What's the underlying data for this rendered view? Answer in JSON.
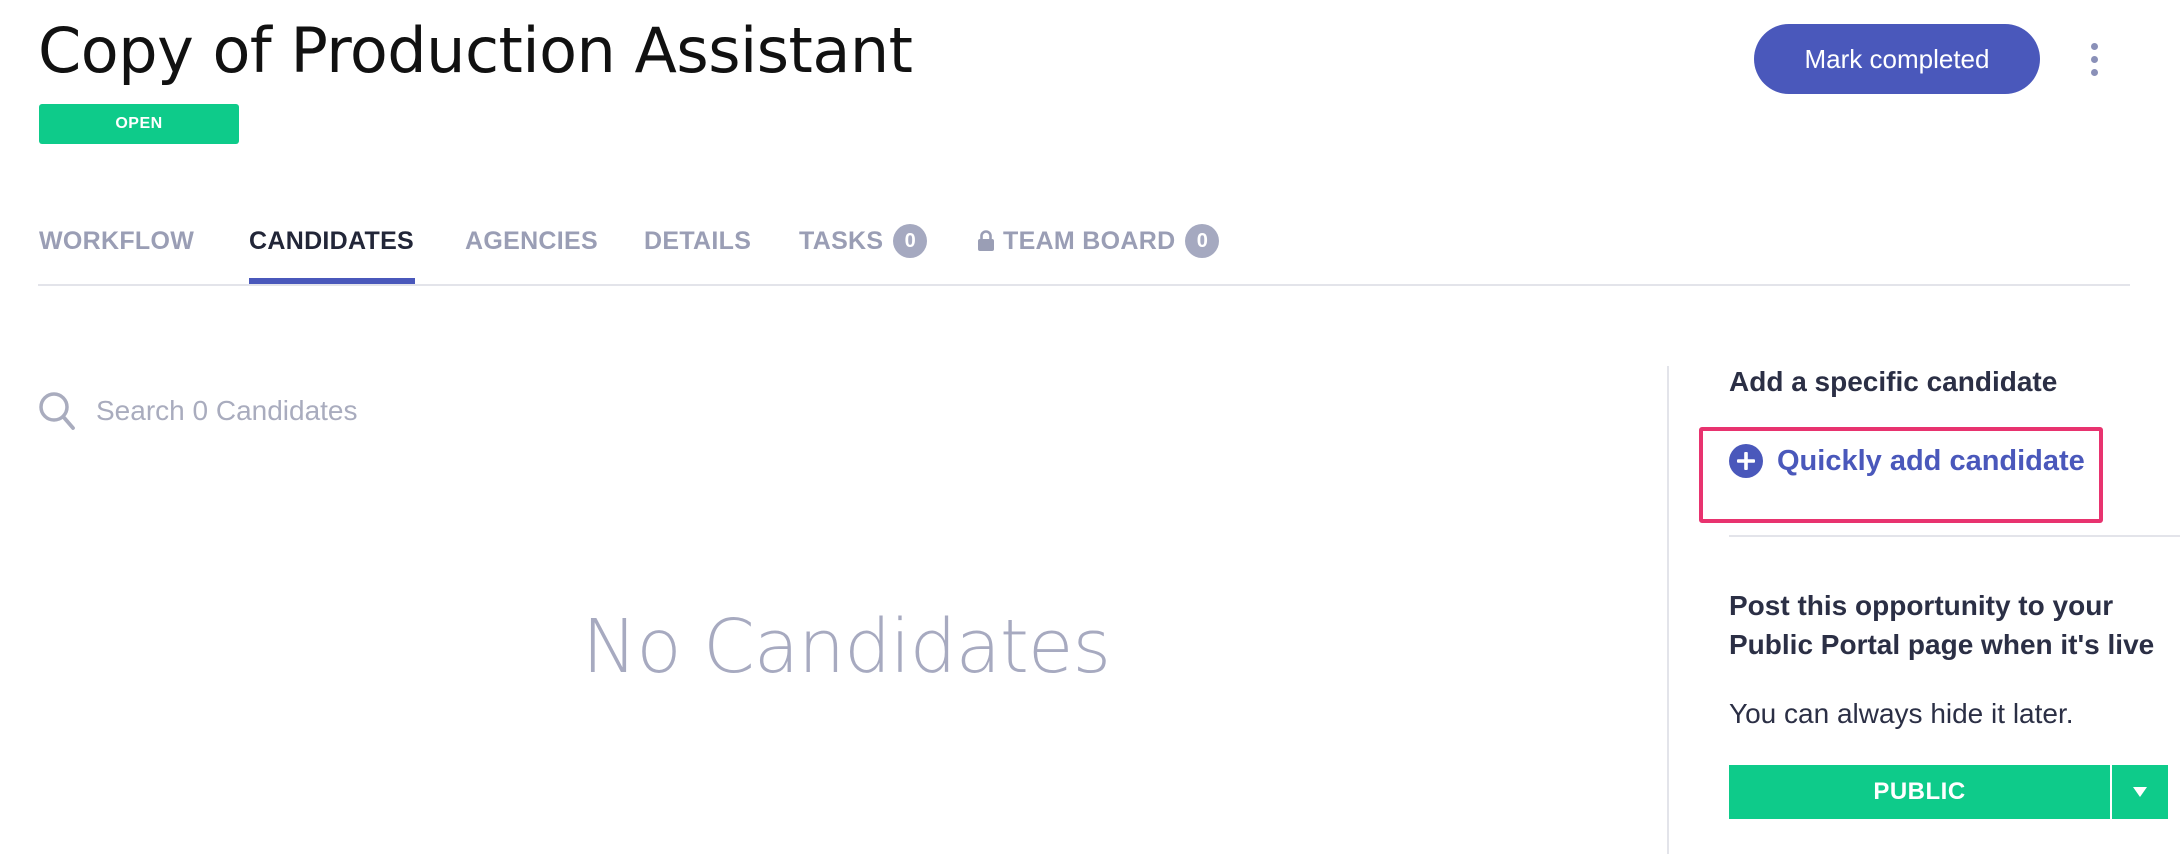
{
  "header": {
    "title": "Copy of Production Assistant",
    "status": "OPEN",
    "primary_action": "Mark completed",
    "more_icon": "kebab-vertical-icon"
  },
  "tabs": [
    {
      "label": "WORKFLOW",
      "count": null,
      "active": false
    },
    {
      "label": "CANDIDATES",
      "count": null,
      "active": true
    },
    {
      "label": "AGENCIES",
      "count": null,
      "active": false
    },
    {
      "label": "DETAILS",
      "count": null,
      "active": false
    },
    {
      "label": "TASKS",
      "count": "0",
      "active": false
    },
    {
      "label": "TEAM BOARD",
      "count": "0",
      "active": false,
      "icon": "lock-icon"
    }
  ],
  "search": {
    "placeholder": "Search 0 Candidates",
    "value": "",
    "icon": "search-icon"
  },
  "main": {
    "empty_message": "No Candidates"
  },
  "sidebar": {
    "heading": "Add a specific candidate",
    "quick_add_label": "Quickly add candidate",
    "quick_add_icon": "plus-circle-icon",
    "portal_text": "Post this opportunity to your Public Portal page when it's live",
    "hint": "You can always hide it later.",
    "visibility_value": "PUBLIC",
    "visibility_dropdown_icon": "caret-down-icon"
  },
  "colors": {
    "accent": "#4a58bb",
    "success": "#0ecb8a",
    "highlight": "#e8336f",
    "muted": "#9a9eb5"
  }
}
